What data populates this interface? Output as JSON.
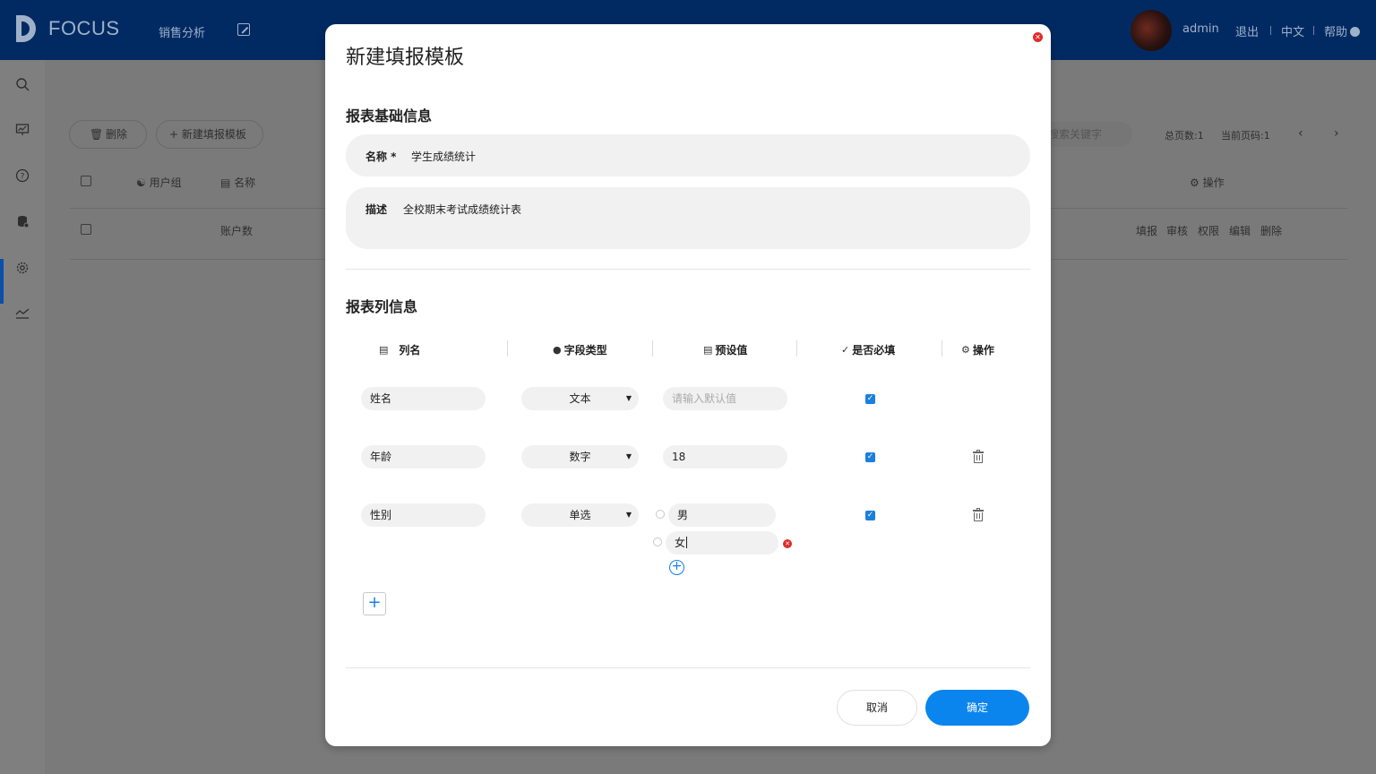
{
  "header": {
    "logo_text": "FOCUS",
    "nav_items": [
      "销售分析"
    ],
    "user": "admin",
    "logout": "退出",
    "language": "中文",
    "help": "帮助"
  },
  "sidebar": {
    "icons": [
      "search-icon",
      "dashboard-icon",
      "help-icon",
      "database-icon",
      "settings-icon",
      "trend-icon"
    ],
    "active_index": 3
  },
  "background": {
    "delete_label": "删除",
    "new_template_label": "+ 新建填报模板",
    "search_placeholder": "搜索关键字",
    "total_pages": "总页数:1",
    "current_page": "当前页码:1",
    "col_usergroup": "用户组",
    "col_name": "名称",
    "col_operation": "操作",
    "row_accounts": "账户数",
    "row_actions": [
      "填报",
      "审核",
      "权限",
      "编辑",
      "删除"
    ]
  },
  "modal": {
    "title": "新建填报模板",
    "basic_section": "报表基础信息",
    "name_label": "名称 *",
    "name_value": "学生成绩统计",
    "desc_label": "描述",
    "desc_value": "全校期末考试成绩统计表",
    "columns_section": "报表列信息",
    "headers": {
      "col_name": "列名",
      "field_type": "字段类型",
      "default_value": "预设值",
      "required": "是否必填",
      "operation": "操作"
    },
    "rows": [
      {
        "name": "姓名",
        "type": "文本",
        "default": "",
        "default_placeholder": "请输入默认值",
        "required": true
      },
      {
        "name": "年龄",
        "type": "数字",
        "default": "18",
        "required": true
      },
      {
        "name": "性别",
        "type": "单选",
        "options": [
          "男",
          "女"
        ],
        "required": true
      }
    ],
    "cancel_label": "取消",
    "ok_label": "确定"
  },
  "colors": {
    "header_bg": "#012a63",
    "primary": "#0b85ee",
    "danger": "#e02b2b"
  }
}
